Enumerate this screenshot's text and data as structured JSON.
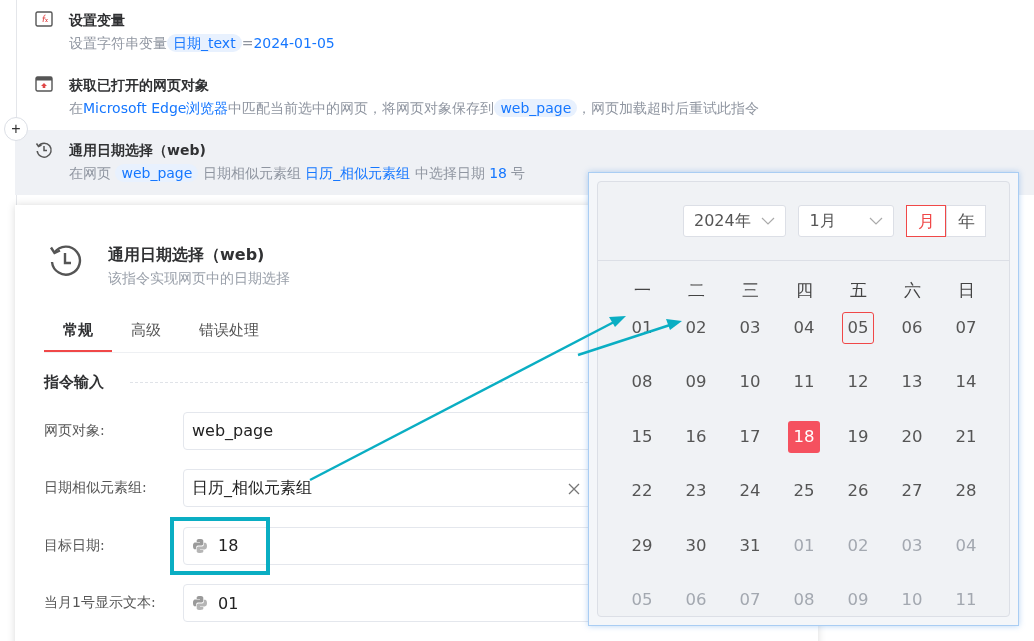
{
  "steps": [
    {
      "kind": "set-variable",
      "title": "设置变量",
      "selected": false,
      "description": [
        {
          "kind": "text",
          "text": "设置字符串变量"
        },
        {
          "kind": "var",
          "text": "日期_text"
        },
        {
          "kind": "text",
          "text": "="
        },
        {
          "kind": "value",
          "text": "2024-01-05"
        }
      ]
    },
    {
      "kind": "get-webpage",
      "title": "获取已打开的网页对象",
      "selected": false,
      "description": [
        {
          "kind": "text",
          "text": "在"
        },
        {
          "kind": "value",
          "text": "Microsoft Edge浏览器"
        },
        {
          "kind": "text",
          "text": "中匹配当前选中的网页，将网页对象保存到"
        },
        {
          "kind": "var",
          "text": "web_page"
        },
        {
          "kind": "text",
          "text": "，网页加载超时后重试此指令"
        }
      ]
    },
    {
      "kind": "date-select",
      "title": "通用日期选择（web)",
      "selected": true,
      "description": [
        {
          "kind": "text",
          "text": "在网页 "
        },
        {
          "kind": "var",
          "text": "web_page"
        },
        {
          "kind": "text",
          "text": " 日期相似元素组 "
        },
        {
          "kind": "value",
          "text": "日历_相似元素组"
        },
        {
          "kind": "text",
          "text": " 中选择日期 "
        },
        {
          "kind": "value",
          "text": "18"
        },
        {
          "kind": "text",
          "text": " 号"
        }
      ]
    }
  ],
  "add_button": "+",
  "dialog": {
    "title": "通用日期选择（web)",
    "subtitle": "该指令实现网页中的日期选择",
    "tabs": [
      {
        "label": "常规",
        "selected": true
      },
      {
        "label": "高级",
        "selected": false
      },
      {
        "label": "错误处理",
        "selected": false
      }
    ],
    "section": "指令输入",
    "fields": [
      {
        "label": "网页对象:",
        "kind": "plain",
        "value": "web_page"
      },
      {
        "label": "日期相似元素组:",
        "kind": "clearable",
        "value": "日历_相似元素组"
      },
      {
        "label": "目标日期:",
        "kind": "expression",
        "value": "18"
      },
      {
        "label": "当月1号显示文本:",
        "kind": "expression",
        "value": "01"
      }
    ]
  },
  "calendar": {
    "year": "2024年",
    "month": "1月",
    "modes": [
      {
        "label": "月",
        "selected": true
      },
      {
        "label": "年",
        "selected": false
      }
    ],
    "weekdays": [
      "一",
      "二",
      "三",
      "四",
      "五",
      "六",
      "日"
    ],
    "days": [
      {
        "label": "01",
        "in_month": true,
        "today": false,
        "selected": false
      },
      {
        "label": "02",
        "in_month": true,
        "today": false,
        "selected": false
      },
      {
        "label": "03",
        "in_month": true,
        "today": false,
        "selected": false
      },
      {
        "label": "04",
        "in_month": true,
        "today": false,
        "selected": false
      },
      {
        "label": "05",
        "in_month": true,
        "today": true,
        "selected": false
      },
      {
        "label": "06",
        "in_month": true,
        "today": false,
        "selected": false
      },
      {
        "label": "07",
        "in_month": true,
        "today": false,
        "selected": false
      },
      {
        "label": "08",
        "in_month": true,
        "today": false,
        "selected": false
      },
      {
        "label": "09",
        "in_month": true,
        "today": false,
        "selected": false
      },
      {
        "label": "10",
        "in_month": true,
        "today": false,
        "selected": false
      },
      {
        "label": "11",
        "in_month": true,
        "today": false,
        "selected": false
      },
      {
        "label": "12",
        "in_month": true,
        "today": false,
        "selected": false
      },
      {
        "label": "13",
        "in_month": true,
        "today": false,
        "selected": false
      },
      {
        "label": "14",
        "in_month": true,
        "today": false,
        "selected": false
      },
      {
        "label": "15",
        "in_month": true,
        "today": false,
        "selected": false
      },
      {
        "label": "16",
        "in_month": true,
        "today": false,
        "selected": false
      },
      {
        "label": "17",
        "in_month": true,
        "today": false,
        "selected": false
      },
      {
        "label": "18",
        "in_month": true,
        "today": false,
        "selected": true
      },
      {
        "label": "19",
        "in_month": true,
        "today": false,
        "selected": false
      },
      {
        "label": "20",
        "in_month": true,
        "today": false,
        "selected": false
      },
      {
        "label": "21",
        "in_month": true,
        "today": false,
        "selected": false
      },
      {
        "label": "22",
        "in_month": true,
        "today": false,
        "selected": false
      },
      {
        "label": "23",
        "in_month": true,
        "today": false,
        "selected": false
      },
      {
        "label": "24",
        "in_month": true,
        "today": false,
        "selected": false
      },
      {
        "label": "25",
        "in_month": true,
        "today": false,
        "selected": false
      },
      {
        "label": "26",
        "in_month": true,
        "today": false,
        "selected": false
      },
      {
        "label": "27",
        "in_month": true,
        "today": false,
        "selected": false
      },
      {
        "label": "28",
        "in_month": true,
        "today": false,
        "selected": false
      },
      {
        "label": "29",
        "in_month": true,
        "today": false,
        "selected": false
      },
      {
        "label": "30",
        "in_month": true,
        "today": false,
        "selected": false
      },
      {
        "label": "31",
        "in_month": true,
        "today": false,
        "selected": false
      },
      {
        "label": "01",
        "in_month": false,
        "today": false,
        "selected": false
      },
      {
        "label": "02",
        "in_month": false,
        "today": false,
        "selected": false
      },
      {
        "label": "03",
        "in_month": false,
        "today": false,
        "selected": false
      },
      {
        "label": "04",
        "in_month": false,
        "today": false,
        "selected": false
      },
      {
        "label": "05",
        "in_month": false,
        "today": false,
        "selected": false
      },
      {
        "label": "06",
        "in_month": false,
        "today": false,
        "selected": false
      },
      {
        "label": "07",
        "in_month": false,
        "today": false,
        "selected": false
      },
      {
        "label": "08",
        "in_month": false,
        "today": false,
        "selected": false
      },
      {
        "label": "09",
        "in_month": false,
        "today": false,
        "selected": false
      },
      {
        "label": "10",
        "in_month": false,
        "today": false,
        "selected": false
      },
      {
        "label": "11",
        "in_month": false,
        "today": false,
        "selected": false
      }
    ]
  }
}
